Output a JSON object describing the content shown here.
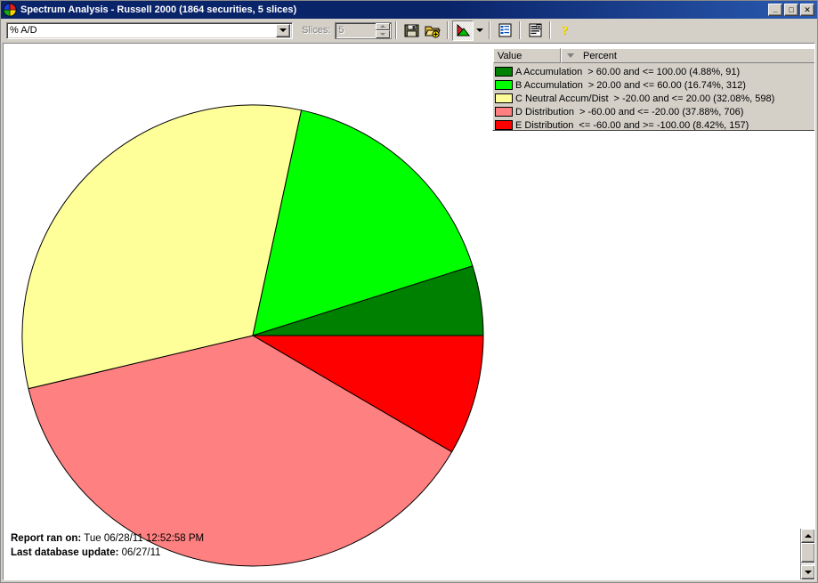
{
  "window": {
    "title": "Spectrum Analysis - Russell 2000 (1864 securities, 5 slices)",
    "app_icon": "pie-chart-icon",
    "controls": {
      "minimize": "_",
      "maximize": "□",
      "close": "✕"
    }
  },
  "toolbar": {
    "indicator_combo": {
      "value": "% A/D",
      "arrow_icon": "chevron-down-icon"
    },
    "slices_label": "Slices:",
    "slices_value": "5",
    "buttons": [
      {
        "name": "save-button",
        "icon": "floppy-disk-icon"
      },
      {
        "name": "open-add-button",
        "icon": "folder-add-icon"
      },
      {
        "name": "chart-view-button",
        "icon": "pie-chart-icon",
        "checked": true
      },
      {
        "name": "chart-view-dropdown",
        "icon": "chevron-down-icon"
      },
      {
        "name": "list-view-button",
        "icon": "list-view-icon"
      },
      {
        "name": "report-view-button",
        "icon": "report-view-icon"
      },
      {
        "name": "help-button",
        "icon": "question-mark-icon"
      }
    ]
  },
  "legend": {
    "columns": [
      {
        "label": "Value",
        "sorted": false
      },
      {
        "label": "Percent",
        "sorted": true,
        "sort_icon": "sort-descending-icon"
      }
    ],
    "rows": [
      {
        "color": "#008000",
        "name": "A Accumulation",
        "range": "> 60.00 and <= 100.00 (4.88%, 91)"
      },
      {
        "color": "#00ff00",
        "name": "B Accumulation",
        "range": "> 20.00 and <= 60.00 (16.74%, 312)"
      },
      {
        "color": "#ffff99",
        "name": "C Neutral Accum/Dist",
        "range": "> -20.00 and <= 20.00 (32.08%, 598)"
      },
      {
        "color": "#ff8080",
        "name": "D Distribution",
        "range": "> -60.00 and <= -20.00 (37.88%, 706)"
      },
      {
        "color": "#ff0000",
        "name": "E Distribution",
        "range": "<= -60.00 and >= -100.00 (8.42%, 157)"
      }
    ]
  },
  "footer": {
    "report_label": "Report ran on:",
    "report_value": "Tue 06/28/11 12:52:58 PM",
    "update_label": "Last database update:",
    "update_value": "06/27/11"
  },
  "scrollbar": {
    "up_icon": "triangle-up-icon",
    "down_icon": "triangle-down-icon"
  },
  "chart_data": {
    "type": "pie",
    "title": "Spectrum Analysis - Russell 2000",
    "total_securities": 1864,
    "slice_count": 5,
    "start_angle_deg": 0,
    "direction": "clockwise",
    "center": [
      280,
      328
    ],
    "radius": 259,
    "labels": [
      "A Accumulation",
      "B Accumulation",
      "C Neutral Accum/Dist",
      "D Distribution",
      "E Distribution"
    ],
    "values": [
      4.88,
      16.74,
      32.08,
      37.88,
      8.42
    ],
    "counts": [
      91,
      312,
      598,
      706,
      157
    ],
    "colors": [
      "#008000",
      "#00ff00",
      "#ffff99",
      "#ff8080",
      "#ff0000"
    ],
    "ranges": [
      "> 60.00 and <= 100.00",
      "> 20.00 and <= 60.00",
      "> -20.00 and <= 20.00",
      "> -60.00 and <= -20.00",
      "<= -60.00 and >= -100.00"
    ],
    "draw_order": [
      "E Distribution",
      "D Distribution",
      "C Neutral Accum/Dist",
      "B Accumulation",
      "A Accumulation"
    ],
    "legend_position": "top-right",
    "ylabel": "",
    "xlabel": ""
  }
}
